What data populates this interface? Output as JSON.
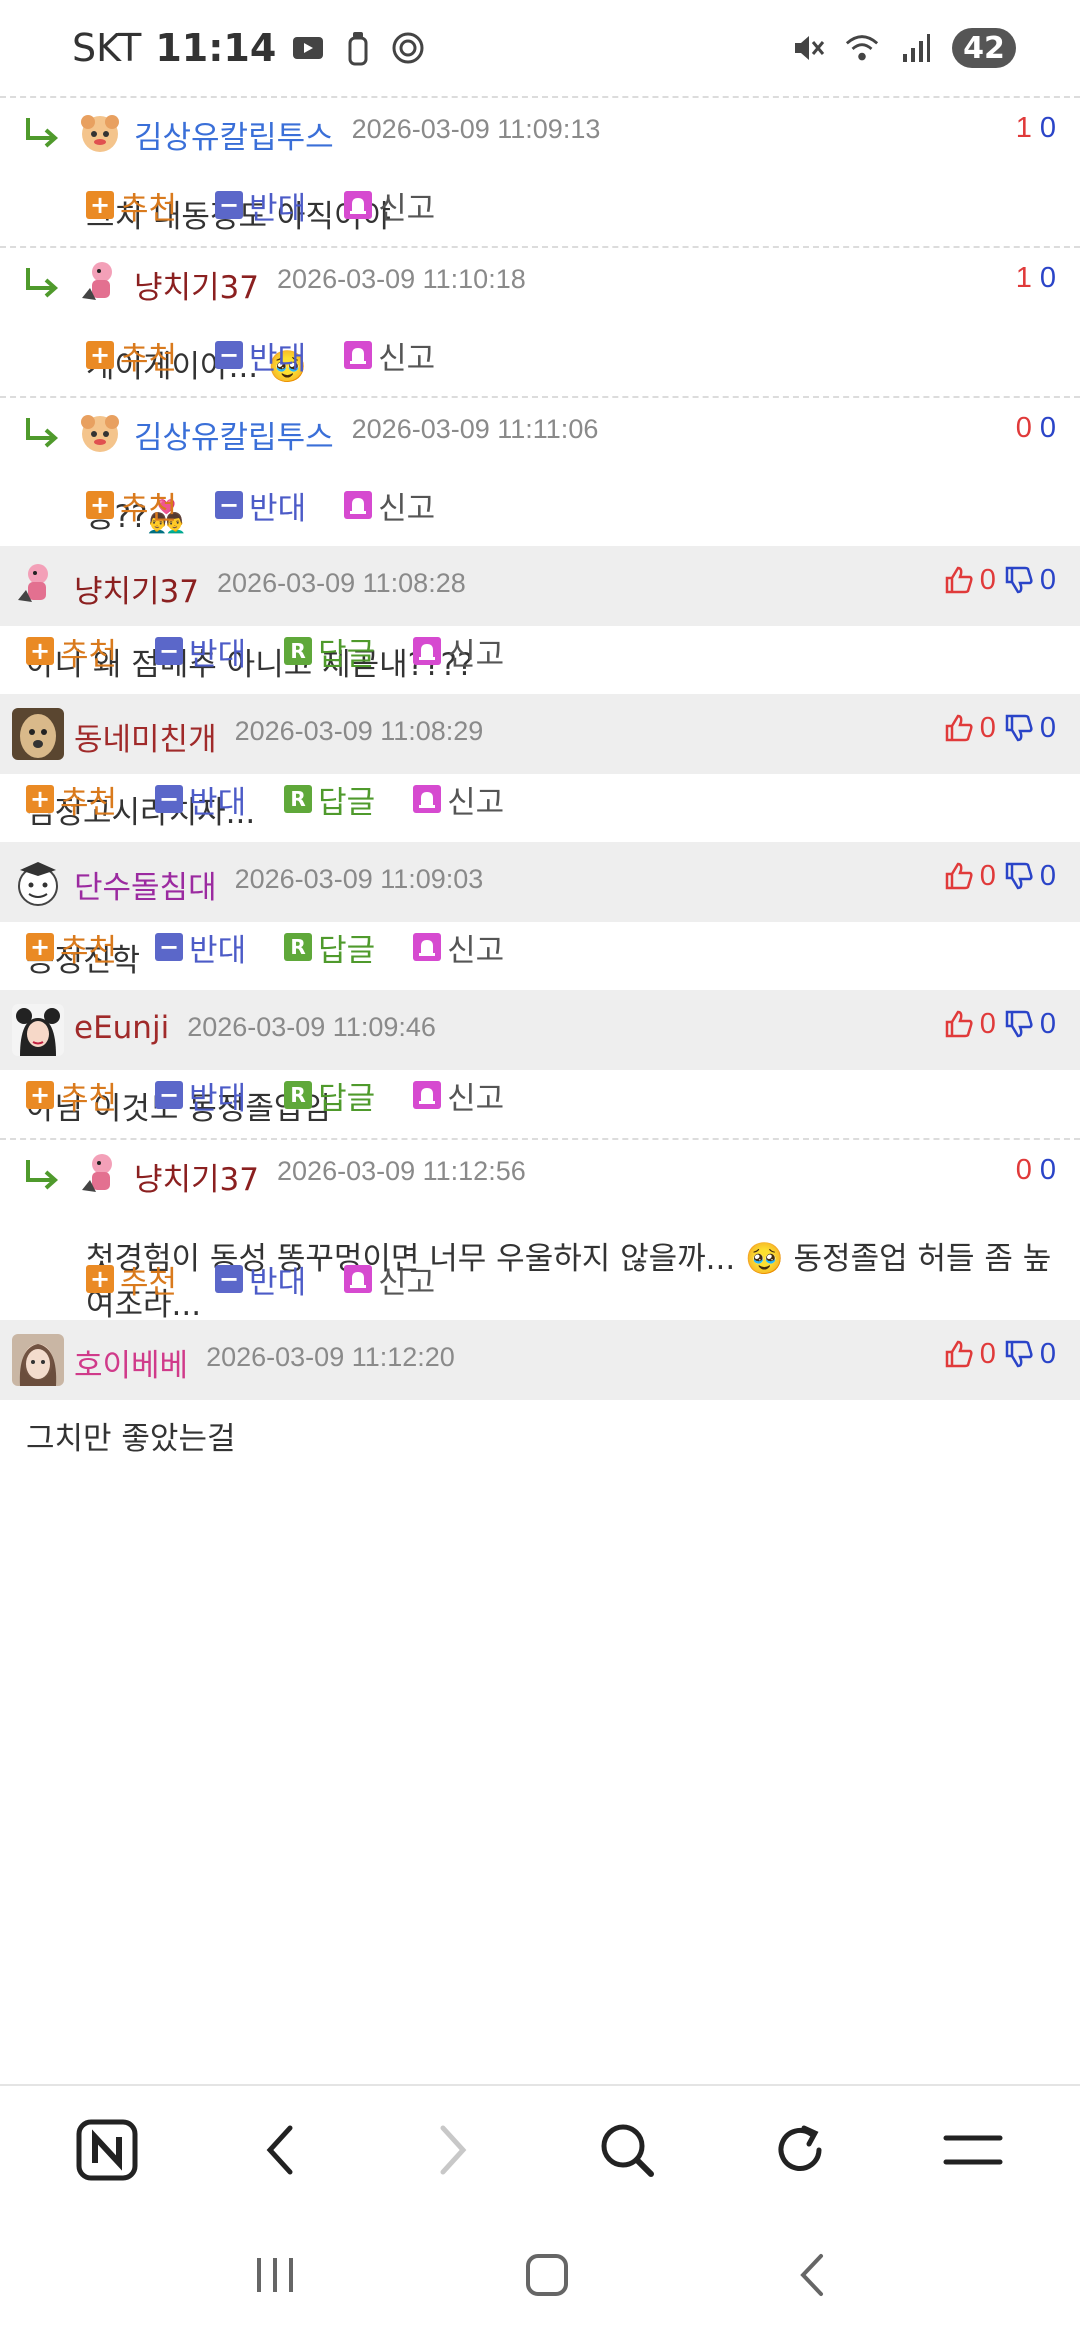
{
  "status_bar": {
    "carrier": "SKT",
    "time": "11:14",
    "battery": "42"
  },
  "comments": [
    {
      "type": "reply",
      "author": "김상유칼립투스",
      "author_color": "#3a6fd8",
      "timestamp": "2026-03-09 11:09:13",
      "up": "1",
      "down": "0",
      "text": [
        "그치 내동정도 아직이야"
      ],
      "actions": {
        "recommend": "추천",
        "oppose": "반대",
        "report": "신고"
      }
    },
    {
      "type": "reply",
      "author": "냥치기37",
      "author_color": "#8b2020",
      "timestamp": "2026-03-09 11:10:18",
      "up": "1",
      "down": "0",
      "text": [
        "게이게이야... 🥹"
      ],
      "actions": {
        "recommend": "추천",
        "oppose": "반대",
        "report": "신고"
      }
    },
    {
      "type": "reply",
      "author": "김상유칼립투스",
      "author_color": "#3a6fd8",
      "timestamp": "2026-03-09 11:11:06",
      "up": "0",
      "down": "0",
      "text": [
        "응??👨‍❤️‍👨"
      ],
      "actions": {
        "recommend": "추천",
        "oppose": "반대",
        "report": "신고"
      }
    },
    {
      "type": "top",
      "author": "냥치기37",
      "author_color": "#8b2020",
      "timestamp": "2026-03-09 11:08:28",
      "up": "0",
      "down": "0",
      "text": [
        "아니 왜 점메추 아니고 제곧내????"
      ],
      "actions": {
        "recommend": "추천",
        "oppose": "반대",
        "reply": "답글",
        "report": "신고"
      }
    },
    {
      "type": "top",
      "author": "동네미친개",
      "author_color": "#a02a2a",
      "timestamp": "2026-03-09 11:08:29",
      "up": "0",
      "down": "0",
      "text": [
        "검정고시라치자..."
      ],
      "actions": {
        "recommend": "추천",
        "oppose": "반대",
        "reply": "답글",
        "report": "신고"
      }
    },
    {
      "type": "top",
      "author": "단수돌침대",
      "author_color": "#9b2aa0",
      "timestamp": "2026-03-09 11:09:03",
      "up": "0",
      "down": "0",
      "text": [
        "동정진학"
      ],
      "actions": {
        "recommend": "추천",
        "oppose": "반대",
        "reply": "답글",
        "report": "신고"
      }
    },
    {
      "type": "top",
      "author": "eEunji",
      "author_color": "#a02a2a",
      "timestamp": "2026-03-09 11:09:46",
      "up": "0",
      "down": "0",
      "text": [
        "아님 이것도 동정졸업임"
      ],
      "actions": {
        "recommend": "추천",
        "oppose": "반대",
        "reply": "답글",
        "report": "신고"
      }
    },
    {
      "type": "reply",
      "author": "냥치기37",
      "author_color": "#8b2020",
      "timestamp": "2026-03-09 11:12:56",
      "up": "0",
      "down": "0",
      "text": [
        "첫경험이 동성 똥꾸멍이면 너무 우울하지 않을까... 🥹 동정졸업 허들 좀 높",
        "여조라..."
      ],
      "actions": {
        "recommend": "추천",
        "oppose": "반대",
        "report": "신고"
      }
    },
    {
      "type": "top",
      "author": "호이베베",
      "author_color": "#d03a8a",
      "timestamp": "2026-03-09 11:12:20",
      "up": "0",
      "down": "0",
      "text": [
        "그치만 좋았는걸"
      ],
      "actions": {}
    }
  ],
  "colors": {
    "up": "#e03a3a",
    "down": "#2a44c8",
    "header_bg": "#eeeeee"
  },
  "toolbar": {
    "icons": [
      "naver-home-icon",
      "back-icon",
      "forward-icon",
      "search-icon",
      "refresh-icon",
      "menu-icon"
    ]
  },
  "nav": {
    "icons": [
      "recent-apps-icon",
      "home-icon",
      "back-nav-icon"
    ]
  }
}
